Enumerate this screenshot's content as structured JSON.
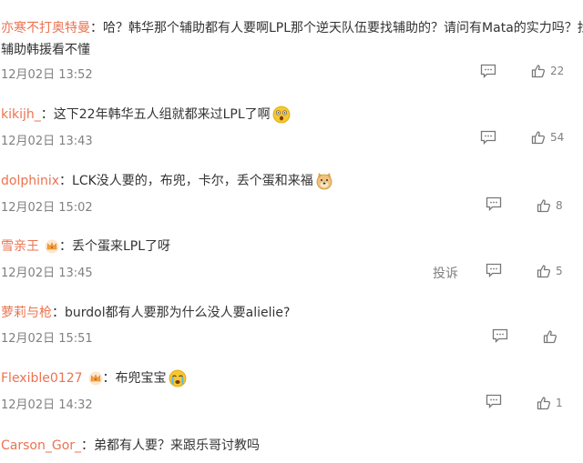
{
  "comments": [
    {
      "user": "亦寒不打奥特曼",
      "sep": "：",
      "text": "哈？韩华那个辅助都有人要啊LPL那个逆天队伍要找辅助的？请问有Mata的实力吗？找",
      "text2": "辅助韩援看不懂",
      "time": "12月02日 13:52",
      "likes": "22"
    },
    {
      "user": "kikijh_",
      "sep": "：",
      "text": "这下22年韩华五人组就都来过LPL了啊",
      "emoji": "surprised-emoji",
      "time": "12月02日 13:43",
      "likes": "54"
    },
    {
      "user": "dolphinix",
      "sep": "：",
      "text": "LCK没人要的，布兜，卡尔，丢个蛋和来福",
      "emoji": "doge-emoji",
      "time": "12月02日 15:02",
      "likes": "8"
    },
    {
      "user": "雪亲王",
      "badge": "crown-icon",
      "sep": "：",
      "text": "丢个蛋来LPL了呀",
      "time": "12月02日 13:45",
      "report": "投诉",
      "likes": "5"
    },
    {
      "user": "萝莉与枪",
      "sep": "：",
      "text": "burdol都有人要那为什么没人要alielie?",
      "time": "12月02日 15:51",
      "likes": ""
    },
    {
      "user": "Flexible0127",
      "badge": "crown-icon",
      "sep": "：",
      "text": "布兜宝宝",
      "emoji": "crying-emoji",
      "time": "12月02日 14:32",
      "likes": "1"
    },
    {
      "user": "Carson_Gor_",
      "sep": "：",
      "text": "弟都有人要？来跟乐哥讨教吗"
    }
  ],
  "colors": {
    "username": "#eb7350",
    "text": "#333333",
    "meta": "#808080"
  }
}
